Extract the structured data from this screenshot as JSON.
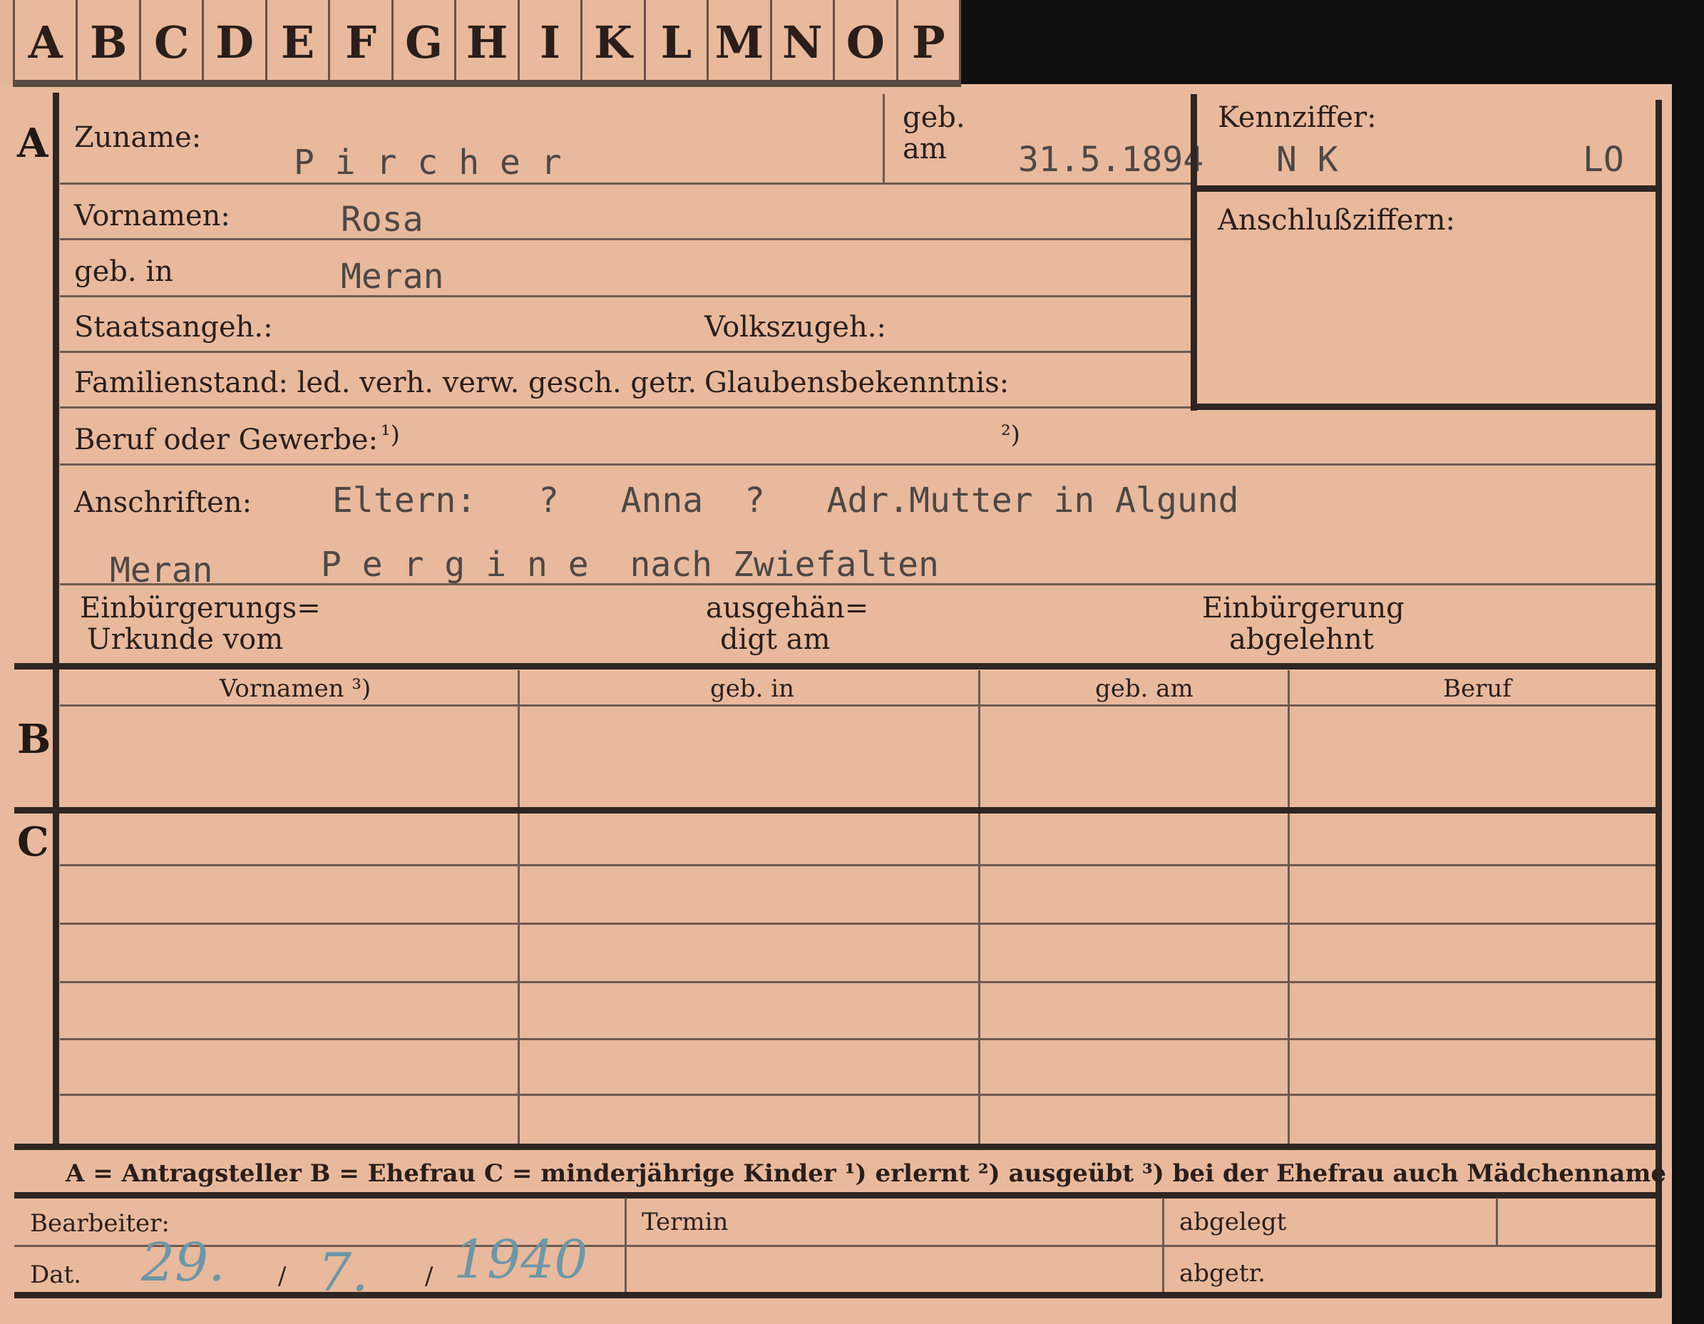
{
  "tabs": [
    "A",
    "B",
    "C",
    "D",
    "E",
    "F",
    "G",
    "H",
    "I",
    "K",
    "L",
    "M",
    "N",
    "O",
    "P"
  ],
  "sections": {
    "a": "A",
    "b": "B",
    "c": "C"
  },
  "labels": {
    "zuname": "Zuname:",
    "geb_am_1": "geb.",
    "geb_am_2": "am",
    "kennziffer": "Kennziffer:",
    "anschlussziffern": "Anschlußziffern:",
    "vornamen": "Vornamen:",
    "geb_in": "geb. in",
    "staatsangeh": "Staatsangeh.:",
    "volkszugeh": "Volkszugeh.:",
    "familienstand": "Familienstand: led. verh. verw. gesch. getr.",
    "glaubensbekenntnis": "Glaubensbekenntnis:",
    "beruf": "Beruf oder Gewerbe:",
    "beruf_mark1": "¹)",
    "beruf_mark2": "²)",
    "anschriften": "Anschriften:",
    "einbuergerung_1": "Einbürgerungs=",
    "einbuergerung_2": "Urkunde vom",
    "ausgehaendigt_1": "ausgehän=",
    "ausgehaendigt_2": "digt am",
    "abgelehnt_1": "Einbürgerung",
    "abgelehnt_2": "abgelehnt"
  },
  "values": {
    "zuname": "P i r c h e r",
    "geb_am": "31.5.1894",
    "kennziffer_left": "N K",
    "kennziffer_right": "LO",
    "vornamen": "Rosa",
    "geb_in": "Meran",
    "anschriften_line1": "Eltern:   ?   Anna  ?   Adr.Mutter in Algund",
    "anschriften_line2_left": "Meran",
    "anschriften_line2_right": "P e r g i n e  nach Zwiefalten"
  },
  "table_headers": [
    "Vornamen ³)",
    "geb. in",
    "geb. am",
    "Beruf"
  ],
  "legend": "A = Antragsteller   B = Ehefrau   C = minderjährige Kinder   ¹) erlernt   ²) ausgeübt   ³) bei der Ehefrau auch Mädchenname",
  "bottom": {
    "bearbeiter": "Bearbeiter:",
    "termin": "Termin",
    "abgelegt": "abgelegt",
    "dat": "Dat.",
    "abgetr": "abgetr.",
    "date_day": "29.",
    "date_month": "7.",
    "date_year": "1940",
    "date_sep": "/"
  }
}
